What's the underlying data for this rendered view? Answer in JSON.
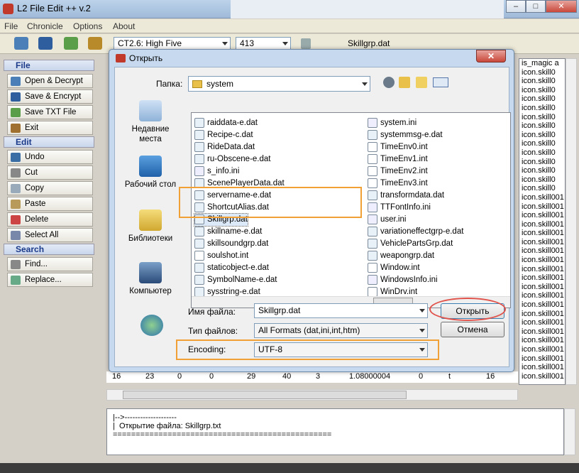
{
  "window": {
    "title": "L2 File Edit ++ v.2",
    "min": "–",
    "max": "□",
    "close": "✕"
  },
  "menu": [
    "File",
    "Chronicle",
    "Options",
    "About"
  ],
  "toolbar": {
    "chronicle": "CT2.6: High Five",
    "version": "413",
    "filename": "Skillgrp.dat"
  },
  "sidebar": {
    "file_header": "File",
    "file_items": [
      "Open & Decrypt",
      "Save & Encrypt",
      "Save TXT File",
      "Exit"
    ],
    "edit_header": "Edit",
    "edit_items": [
      "Undo",
      "Cut",
      "Copy",
      "Paste",
      "Delete",
      "Select All"
    ],
    "search_header": "Search",
    "search_items": [
      "Find...",
      "Replace..."
    ]
  },
  "right_list": [
    "is_magic a",
    "icon.skill0",
    "icon.skill0",
    "icon.skill0",
    "icon.skill0",
    "icon.skill0",
    "icon.skill0",
    "icon.skill0",
    "icon.skill0",
    "icon.skill0",
    "icon.skill0",
    "icon.skill0",
    "icon.skill0",
    "icon.skill0",
    "icon.skill0",
    "icon.skill001",
    "icon.skill001",
    "icon.skill001",
    "icon.skill001",
    "icon.skill001",
    "icon.skill001",
    "icon.skill001",
    "icon.skill001",
    "icon.skill001",
    "icon.skill001",
    "icon.skill001",
    "icon.skill001",
    "icon.skill001",
    "icon.skill001",
    "icon.skill001",
    "icon.skill001",
    "icon.skill001",
    "icon.skill001",
    "icon.skill001",
    "icon.skill001",
    "icon.skill001"
  ],
  "data_row": [
    "16",
    "23",
    "0",
    "0",
    "29",
    "40",
    "3",
    "1.08000004",
    "0",
    "t",
    "16"
  ],
  "log": [
    "|-->--------------------",
    "|  Открытие файла: Skillgrp.txt",
    "================================================"
  ],
  "dialog": {
    "title": "Открыть",
    "close": "✕",
    "folder_label": "Папка:",
    "folder_value": "system",
    "places": [
      "Недавние места",
      "Рабочий стол",
      "Библиотеки",
      "Компьютер"
    ],
    "files_left": [
      {
        "name": "raiddata-e.dat",
        "type": "dat"
      },
      {
        "name": "Recipe-c.dat",
        "type": "dat"
      },
      {
        "name": "RideData.dat",
        "type": "dat"
      },
      {
        "name": "ru-Obscene-e.dat",
        "type": "dat"
      },
      {
        "name": "s_info.ini",
        "type": "ini"
      },
      {
        "name": "ScenePlayerData.dat",
        "type": "dat"
      },
      {
        "name": "servername-e.dat",
        "type": "dat"
      },
      {
        "name": "ShortcutAlias.dat",
        "type": "dat"
      },
      {
        "name": "Skillgrp.dat",
        "type": "dat"
      },
      {
        "name": "skillname-e.dat",
        "type": "dat"
      },
      {
        "name": "skillsoundgrp.dat",
        "type": "dat"
      },
      {
        "name": "soulshot.int",
        "type": "int"
      },
      {
        "name": "staticobject-e.dat",
        "type": "dat"
      },
      {
        "name": "SymbolName-e.dat",
        "type": "dat"
      },
      {
        "name": "sysstring-e.dat",
        "type": "dat"
      }
    ],
    "files_right": [
      {
        "name": "system.ini",
        "type": "ini"
      },
      {
        "name": "systemmsg-e.dat",
        "type": "dat"
      },
      {
        "name": "TimeEnv0.int",
        "type": "int"
      },
      {
        "name": "TimeEnv1.int",
        "type": "int"
      },
      {
        "name": "TimeEnv2.int",
        "type": "int"
      },
      {
        "name": "TimeEnv3.int",
        "type": "int"
      },
      {
        "name": "transformdata.dat",
        "type": "dat"
      },
      {
        "name": "TTFontInfo.ini",
        "type": "ini"
      },
      {
        "name": "user.ini",
        "type": "ini"
      },
      {
        "name": "variationeffectgrp-e.dat",
        "type": "dat"
      },
      {
        "name": "VehiclePartsGrp.dat",
        "type": "dat"
      },
      {
        "name": "weapongrp.dat",
        "type": "dat"
      },
      {
        "name": "Window.int",
        "type": "int"
      },
      {
        "name": "WindowsInfo.ini",
        "type": "ini"
      },
      {
        "name": "WinDrv.int",
        "type": "int"
      }
    ],
    "filename_label": "Имя файла:",
    "filename_value": "Skillgrp.dat",
    "filetype_label": "Тип файлов:",
    "filetype_value": "All Formats (dat,ini,int,htm)",
    "encoding_label": "Encoding:",
    "encoding_value": "UTF-8",
    "open_button": "Открыть",
    "cancel_button": "Отмена"
  },
  "colors": {
    "highlight_box": "#f0a035",
    "open_circle": "#e0524a",
    "selection": "#dbe9f8"
  }
}
